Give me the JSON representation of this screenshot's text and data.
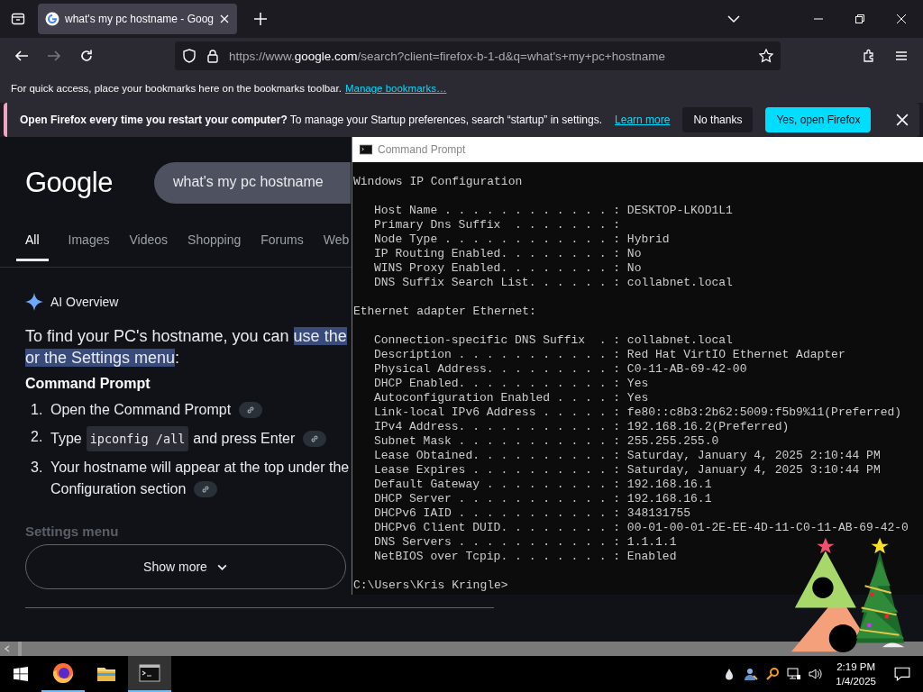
{
  "browser": {
    "tab": {
      "title": "what's my pc hostname - Goog",
      "selected": true
    },
    "url_parts": [
      {
        "text": "https://www.",
        "emphasis": false
      },
      {
        "text": "google.com",
        "emphasis": true
      },
      {
        "text": "/search?client=firefox-b-1-d&q=what's+my+pc+hostname",
        "emphasis": false
      }
    ],
    "bookmarks_bar": {
      "message": "For quick access, place your bookmarks here on the bookmarks toolbar.",
      "link": "Manage bookmarks…"
    },
    "infobar": {
      "title": "Open Firefox every time you restart your computer?",
      "message": "To manage your Startup preferences, search “startup” in settings.",
      "link": "Learn more",
      "buttons": [
        {
          "label": "No thanks",
          "kind": "secondary"
        },
        {
          "label": "Yes, open Firefox",
          "kind": "primary"
        }
      ]
    }
  },
  "google": {
    "logo": "Google",
    "query": "what's my pc hostname",
    "tabs": [
      {
        "label": "All",
        "selected": true
      },
      {
        "label": "Images",
        "selected": false
      },
      {
        "label": "Videos",
        "selected": false
      },
      {
        "label": "Shopping",
        "selected": false
      },
      {
        "label": "Forums",
        "selected": false
      },
      {
        "label": "Web",
        "selected": false
      }
    ],
    "ai_overview": "AI Overview",
    "summary_lines": [
      [
        {
          "text": "To find your PC's hostname, you can",
          "highlighted": false
        },
        {
          "text": "use the",
          "highlighted": true
        }
      ],
      [
        {
          "text": "or the Settings menu",
          "highlighted": true
        },
        {
          "text": ":",
          "highlighted": false
        }
      ]
    ],
    "section": "Command Prompt",
    "steps": [
      {
        "number": "1.",
        "parts": [
          {
            "text": "Open the Command Prompt",
            "kind": "text"
          }
        ]
      },
      {
        "number": "2.",
        "parts": [
          {
            "text": "Type",
            "kind": "text"
          },
          {
            "text": "ipconfig /all",
            "kind": "code"
          },
          {
            "text": "and press Enter",
            "kind": "text"
          }
        ]
      },
      {
        "number": "3.",
        "parts": [
          {
            "text": "Your hostname will appear at the top under the",
            "kind": "text"
          },
          {
            "text": "Configuration section",
            "kind": "text"
          }
        ]
      }
    ],
    "faded_heading": "Settings menu",
    "show_more": "Show more"
  },
  "cmd": {
    "title": "Command Prompt",
    "sections": [
      {
        "heading": "Windows IP Configuration",
        "entries": [
          {
            "label": "Host Name . . . . . . . . . . . . :",
            "value": "DESKTOP-LKOD1L1"
          },
          {
            "label": "Primary Dns Suffix  . . . . . . . :"
          },
          {
            "label": "Node Type . . . . . . . . . . . . :",
            "value": "Hybrid"
          },
          {
            "label": "IP Routing Enabled. . . . . . . . :",
            "value": "No"
          },
          {
            "label": "WINS Proxy Enabled. . . . . . . . :",
            "value": "No"
          },
          {
            "label": "DNS Suffix Search List. . . . . . :",
            "value": "collabnet.local"
          }
        ]
      },
      {
        "heading": "Ethernet adapter Ethernet:",
        "entries": [
          {
            "label": "Connection-specific DNS Suffix  . :",
            "value": "collabnet.local"
          },
          {
            "label": "Description . . . . . . . . . . . :",
            "value": "Red Hat VirtIO Ethernet Adapter"
          },
          {
            "label": "Physical Address. . . . . . . . . :",
            "value": "C0-11-AB-69-42-00"
          },
          {
            "label": "DHCP Enabled. . . . . . . . . . . :",
            "value": "Yes"
          },
          {
            "label": "Autoconfiguration Enabled . . . . :",
            "value": "Yes"
          },
          {
            "label": "Link-local IPv6 Address . . . . . :",
            "value": "fe80::c8b3:2b62:5009:f5b9%11(Preferred)"
          },
          {
            "label": "IPv4 Address. . . . . . . . . . . :",
            "value": "192.168.16.2(Preferred)"
          },
          {
            "label": "Subnet Mask . . . . . . . . . . . :",
            "value": "255.255.255.0"
          },
          {
            "label": "Lease Obtained. . . . . . . . . . :",
            "value": "Saturday, January 4, 2025 2:10:44 PM"
          },
          {
            "label": "Lease Expires . . . . . . . . . . :",
            "value": "Saturday, January 4, 2025 3:10:44 PM"
          },
          {
            "label": "Default Gateway . . . . . . . . . :",
            "value": "192.168.16.1"
          },
          {
            "label": "DHCP Server . . . . . . . . . . . :",
            "value": "192.168.16.1"
          },
          {
            "label": "DHCPv6 IAID . . . . . . . . . . . :",
            "value": "348131755"
          },
          {
            "label": "DHCPv6 Client DUID. . . . . . . . :",
            "value": "00-01-00-01-2E-EE-4D-11-C0-11-AB-69-42-0"
          },
          {
            "label": "DNS Servers . . . . . . . . . . . :",
            "value": "1.1.1.1"
          },
          {
            "label": "NetBIOS over Tcpip. . . . . . . . :",
            "value": "Enabled"
          }
        ]
      }
    ],
    "prompt": "C:\\Users\\Kris Kringle>"
  },
  "taskbar": {
    "apps": [
      {
        "kind": "firefox",
        "running": true,
        "active": false
      },
      {
        "kind": "explorer",
        "running": false,
        "active": false
      },
      {
        "kind": "terminal",
        "running": true,
        "active": true
      }
    ],
    "time": "2:19 PM",
    "date": "1/4/2025"
  }
}
